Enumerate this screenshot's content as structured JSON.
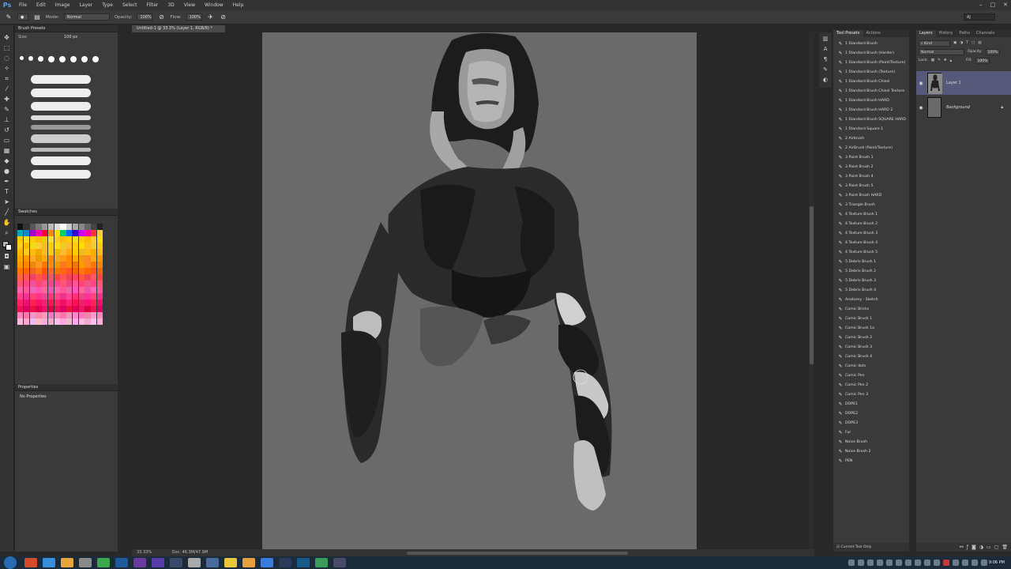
{
  "menu": {
    "logo": "Ps",
    "items": [
      "File",
      "Edit",
      "Image",
      "Layer",
      "Type",
      "Select",
      "Filter",
      "3D",
      "View",
      "Window",
      "Help"
    ]
  },
  "options": {
    "mode_label": "Mode:",
    "mode_value": "Normal",
    "opacity_label": "Opacity:",
    "opacity_value": "100%",
    "flow_label": "Flow:",
    "flow_value": "100%",
    "workspace": "AJ"
  },
  "left": {
    "brush_presets_tab": "Brush Presets",
    "size_label": "Size:",
    "size_value": "100 px",
    "swatches_tab": "Swatches",
    "properties_tab": "Properties",
    "no_properties": "No Properties"
  },
  "document": {
    "tab": "Untitled-1 @ 33.3% (Layer 1, RGB/8) *",
    "zoom": "33.33%",
    "doc_size": "Doc: 46.3M/47.9M"
  },
  "tool_presets": {
    "tabs": [
      "Tool Presets",
      "Actions"
    ],
    "items": [
      "1 Standard Brush",
      "1 Standard Brush (Harder)",
      "1 Standard Brush (Paint/Texture)",
      "1 Standard Brush (Texture)",
      "1 Standard Brush Chisel",
      "1 Standard Brush Chisel Texture",
      "1 Standard Brush HARD",
      "1 Standard Brush HARD 2",
      "1 Standard Brush SQUARE HARD",
      "1 Standard Square 1",
      "2 Airbrush",
      "2 AirBrush (Paint/Texture)",
      "3 Paint Brush 1",
      "3 Paint Brush 2",
      "3 Paint Brush 4",
      "3 Paint Brush 5",
      "3 Paint Brush HARD",
      "3 Triangle Brush",
      "4 Texture Brush 1",
      "4 Texture Brush 2",
      "4 Texture Brush 3",
      "4 Texture Brush 4",
      "4 Texture Brush 5",
      "5 Debris Brush 1",
      "5 Debris Brush 2",
      "5 Debris Brush 3",
      "5 Debris Brush 4",
      "Anatomy - Sketch",
      "Comic Bricks",
      "Comic Brush 1",
      "Comic Brush 1a",
      "Comic Brush 2",
      "Comic Brush 3",
      "Comic Brush 4",
      "Comic dots",
      "Comic Pen",
      "Comic Pen 2",
      "Comic Pen 3",
      "DOPE1",
      "DOPE2",
      "DOPE3",
      "Fur",
      "Noise Brush",
      "Noise Brush 2",
      "PEN"
    ],
    "footer": "Current Tool Only"
  },
  "layers": {
    "tabs": [
      "Layers",
      "History",
      "Paths",
      "Channels"
    ],
    "filter_kind": "Kind",
    "blend_mode": "Normal",
    "opacity_label": "Opacity:",
    "opacity_value": "100%",
    "lock_label": "Lock:",
    "fill_label": "Fill:",
    "fill_value": "100%",
    "items": [
      {
        "name": "Layer 1",
        "selected": true
      },
      {
        "name": "Background",
        "selected": false
      }
    ]
  },
  "taskbar": {
    "clock": "9:06 PM"
  },
  "colors": {
    "canvas": "#6a6a6a",
    "selected_layer": "#56597a",
    "app_bg": "#282828"
  }
}
